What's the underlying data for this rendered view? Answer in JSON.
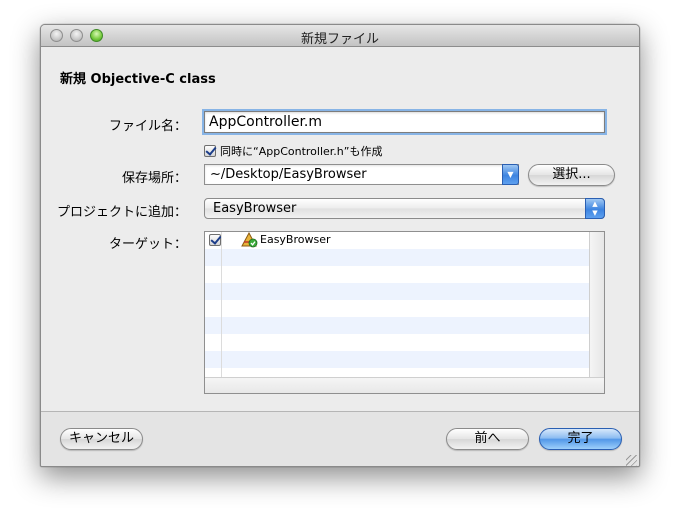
{
  "window": {
    "title": "新規ファイル"
  },
  "heading": "新規 Objective-C class",
  "form": {
    "filename_label": "ファイル名：",
    "filename_value": "AppController.m",
    "also_create_label": "同時に“AppController.h”も作成",
    "also_create_checked": true,
    "location_label": "保存場所：",
    "location_value": "~/Desktop/EasyBrowser",
    "choose_button": "選択...",
    "add_to_project_label": "プロジェクトに追加：",
    "add_to_project_value": "EasyBrowser",
    "targets_label": "ターゲット："
  },
  "targets": [
    {
      "name": "EasyBrowser",
      "checked": true,
      "icon": "application-target-icon"
    }
  ],
  "footer": {
    "cancel_button": "キャンセル",
    "back_button": "前へ",
    "finish_button": "完了"
  },
  "colors": {
    "accent": "#3d84e0",
    "focus_ring": "#87b4e6",
    "row_stripe": "#edf3fe"
  }
}
